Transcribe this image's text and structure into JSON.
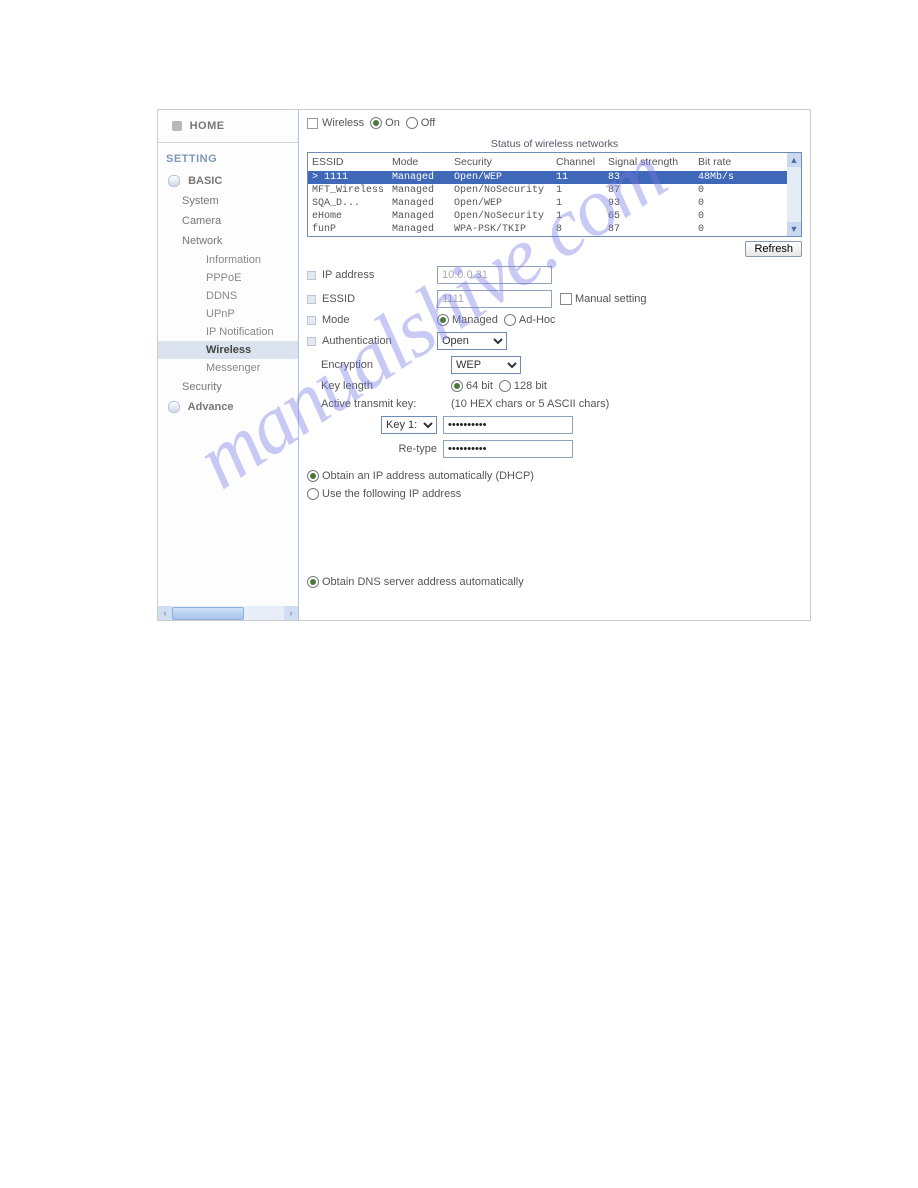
{
  "sidebar": {
    "home": "HOME",
    "setting": "SETTING",
    "basic": "BASIC",
    "system": "System",
    "camera": "Camera",
    "network": "Network",
    "net_items": {
      "information": "Information",
      "pppoe": "PPPoE",
      "ddns": "DDNS",
      "upnp": "UPnP",
      "ipnotif": "IP Notification",
      "wireless": "Wireless",
      "messenger": "Messenger"
    },
    "security": "Security",
    "advance": "Advance"
  },
  "top": {
    "wireless_label": "Wireless",
    "on": "On",
    "off": "Off"
  },
  "networks": {
    "title": "Status of wireless networks",
    "cols": {
      "essid": "ESSID",
      "mode": "Mode",
      "security": "Security",
      "channel": "Channel",
      "signal": "Signal strength",
      "bitrate": "Bit rate"
    },
    "rows": [
      {
        "essid": "> 1111",
        "mode": "Managed",
        "security": "Open/WEP",
        "channel": "11",
        "signal": "83",
        "bitrate": "48Mb/s",
        "selected": true
      },
      {
        "essid": "MFT_Wireless",
        "mode": "Managed",
        "security": "Open/NoSecurity",
        "channel": "1",
        "signal": "87",
        "bitrate": "0"
      },
      {
        "essid": "SQA_D...",
        "mode": "Managed",
        "security": "Open/WEP",
        "channel": "1",
        "signal": "93",
        "bitrate": "0"
      },
      {
        "essid": "eHome",
        "mode": "Managed",
        "security": "Open/NoSecurity",
        "channel": "1",
        "signal": "65",
        "bitrate": "0"
      },
      {
        "essid": "funP",
        "mode": "Managed",
        "security": "WPA-PSK/TKIP",
        "channel": "8",
        "signal": "87",
        "bitrate": "0"
      }
    ],
    "refresh": "Refresh"
  },
  "form": {
    "ip_address_label": "IP address",
    "ip_address_value": "10.0.0.31",
    "essid_label": "ESSID",
    "essid_value": "1111",
    "manual_setting": "Manual setting",
    "mode_label": "Mode",
    "mode_managed": "Managed",
    "mode_adhoc": "Ad-Hoc",
    "auth_label": "Authentication",
    "auth_value": "Open",
    "enc_label": "Encryption",
    "enc_value": "WEP",
    "keylen_label": "Key length",
    "keylen_64": "64 bit",
    "keylen_128": "128 bit",
    "atk_label": "Active transmit key:",
    "atk_hint": "(10 HEX chars or 5 ASCII chars)",
    "key1_label": "Key 1:",
    "key_value": "••••••••••",
    "retype_label": "Re-type",
    "retype_value": "••••••••••"
  },
  "ipopts": {
    "dhcp": "Obtain an IP address automatically (DHCP)",
    "static": "Use the following IP address",
    "dns_auto": "Obtain DNS server address automatically"
  },
  "watermark": "manualshive.com"
}
